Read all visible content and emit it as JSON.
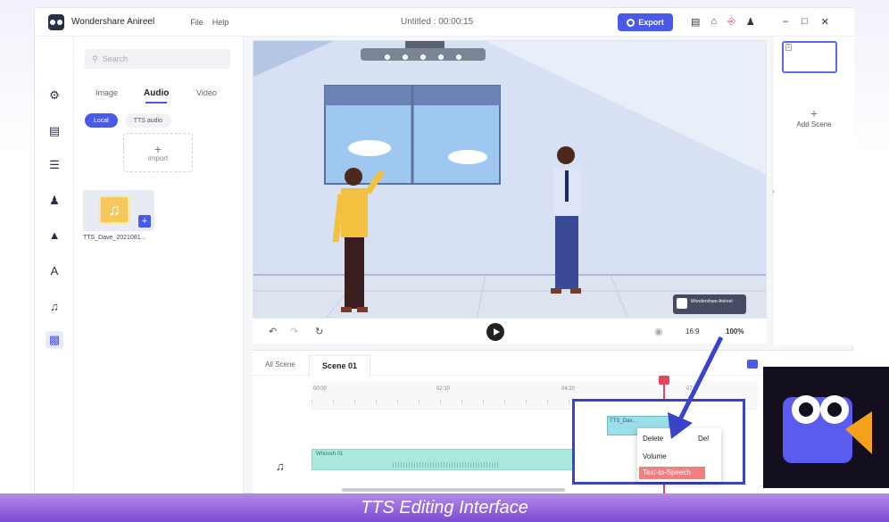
{
  "titlebar": {
    "app_name": "Wondershare Anireel",
    "menu_file": "File",
    "menu_help": "Help",
    "doc_title": "Untitled : 00:00:15",
    "export_label": "Export"
  },
  "library": {
    "search_placeholder": "Search",
    "tabs": [
      "Image",
      "Audio",
      "Video"
    ],
    "active_tab": "Audio",
    "chips": [
      "Local",
      "TTS audio"
    ],
    "import_label": "import",
    "asset_name": "TTS_Dave_2021081..."
  },
  "stage": {
    "watermark": "Wondershare Anireel"
  },
  "stage_toolbar": {
    "ratio": "16:9",
    "zoom": "100%"
  },
  "scenes": {
    "thumb_number": "1",
    "add_scene_label": "Add Scene"
  },
  "timeline": {
    "tab_all": "All Scene",
    "tab_scene": "Scene 01",
    "ruler": [
      "00:00",
      "02:10",
      "04:20",
      "07:..."
    ],
    "audio_clip_label": "Whoosh 01",
    "tts_clip_label": "TTS_Dav..."
  },
  "context_menu": {
    "delete": "Delete",
    "delete_key": "Del",
    "volume": "Volume",
    "tts": "Text-to-Speech"
  },
  "caption": "TTS Editing Interface",
  "colors": {
    "accent": "#4a5ae8",
    "caption_bg": "#9a6ae0",
    "highlight": "#3b43c9",
    "tts_highlight": "#f08080"
  }
}
